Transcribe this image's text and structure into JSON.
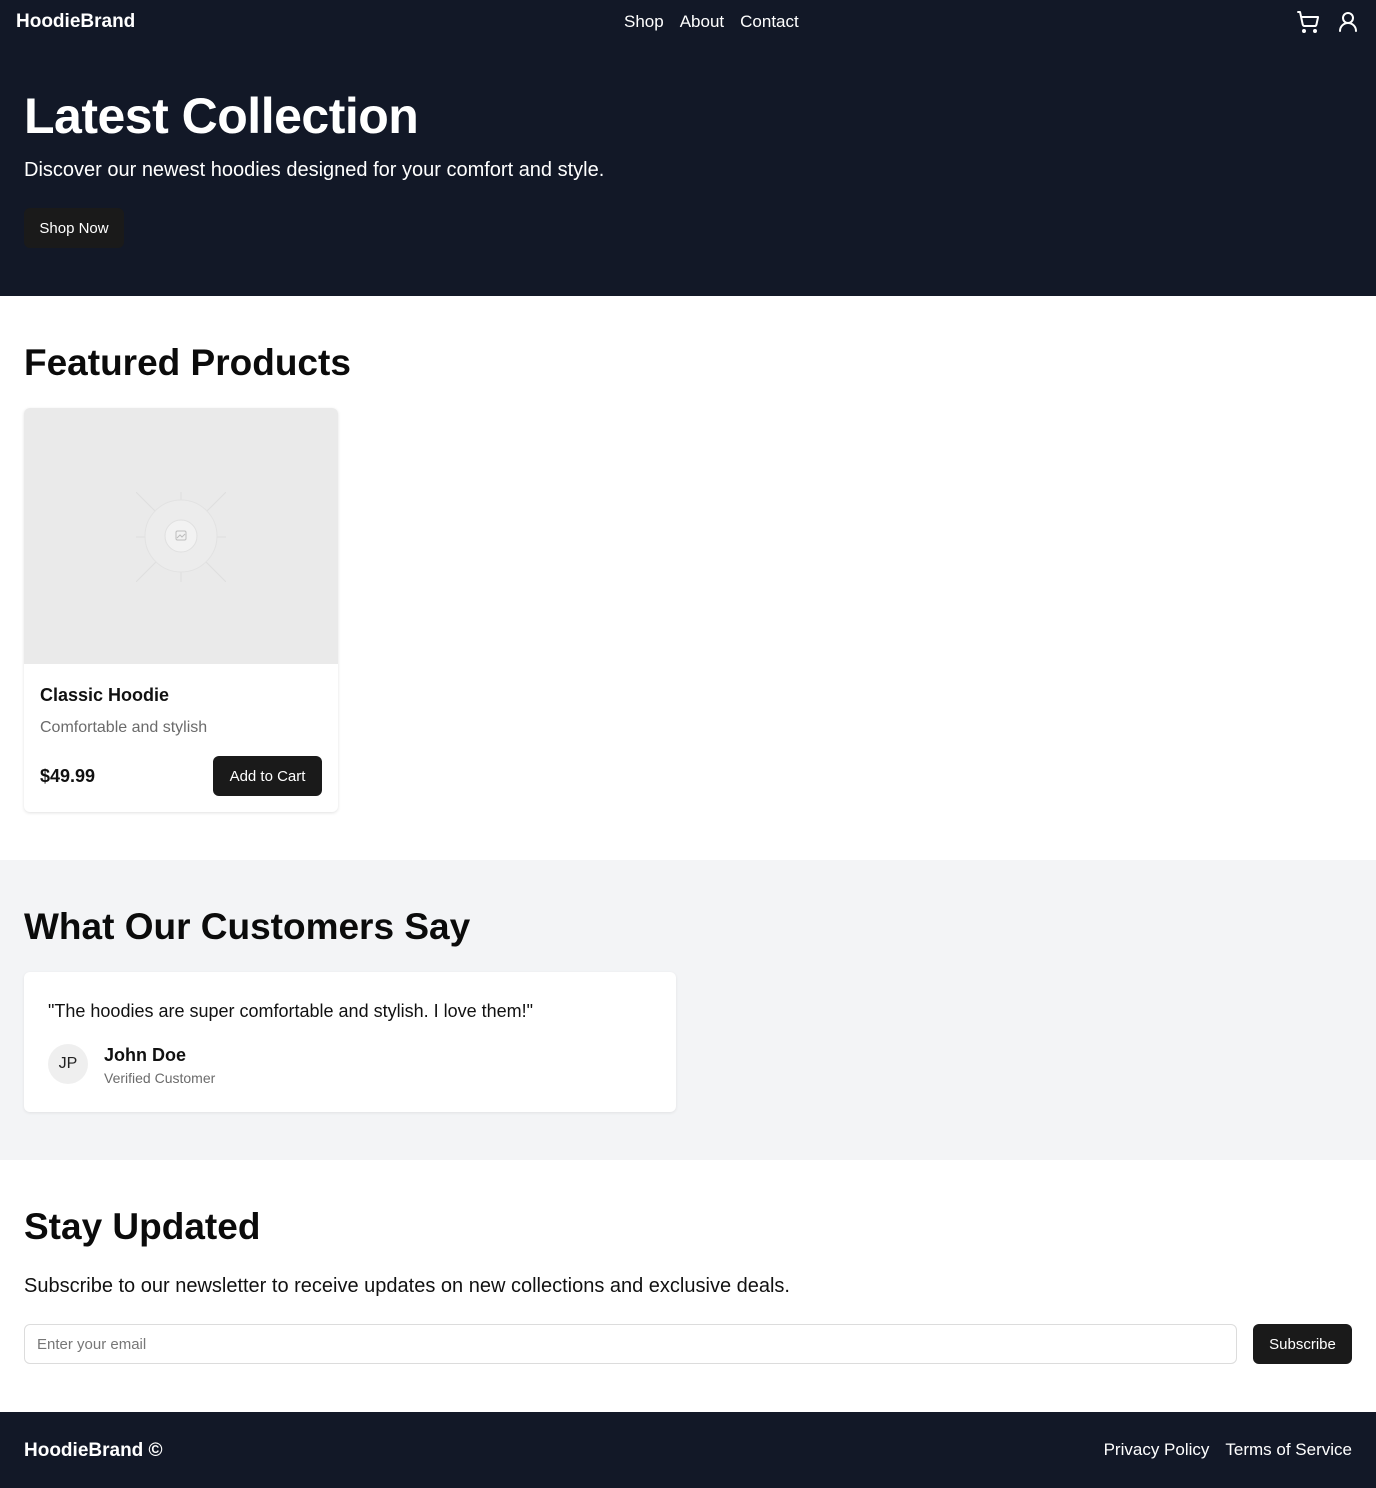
{
  "nav": {
    "brand": "HoodieBrand",
    "links": [
      "Shop",
      "About",
      "Contact"
    ],
    "icons": [
      "cart-icon",
      "user-icon"
    ]
  },
  "hero": {
    "title": "Latest Collection",
    "subtitle": "Discover our newest hoodies designed for your comfort and style.",
    "cta_label": "Shop Now"
  },
  "featured": {
    "title": "Featured Products",
    "products": [
      {
        "name": "Classic Hoodie",
        "description": "Comfortable and stylish",
        "price": "$49.99",
        "cta_label": "Add to Cart",
        "image_icon": "image-placeholder-icon"
      }
    ]
  },
  "testimonials": {
    "title": "What Our Customers Say",
    "items": [
      {
        "quote": "\"The hoodies are super comfortable and stylish. I love them!\"",
        "initials": "JP",
        "name": "John Doe",
        "role": "Verified Customer"
      }
    ]
  },
  "newsletter": {
    "title": "Stay Updated",
    "subtitle": "Subscribe to our newsletter to receive updates on new collections and exclusive deals.",
    "email_placeholder": "Enter your email",
    "email_value": "",
    "button_label": "Subscribe"
  },
  "footer": {
    "brand": "HoodieBrand ©",
    "links": [
      "Privacy Policy",
      "Terms of Service"
    ]
  },
  "colors": {
    "dark_bg": "#121827",
    "button_bg": "#1a1a1a",
    "section_alt_bg": "#f3f4f6",
    "muted_text": "#6b6b6b"
  }
}
